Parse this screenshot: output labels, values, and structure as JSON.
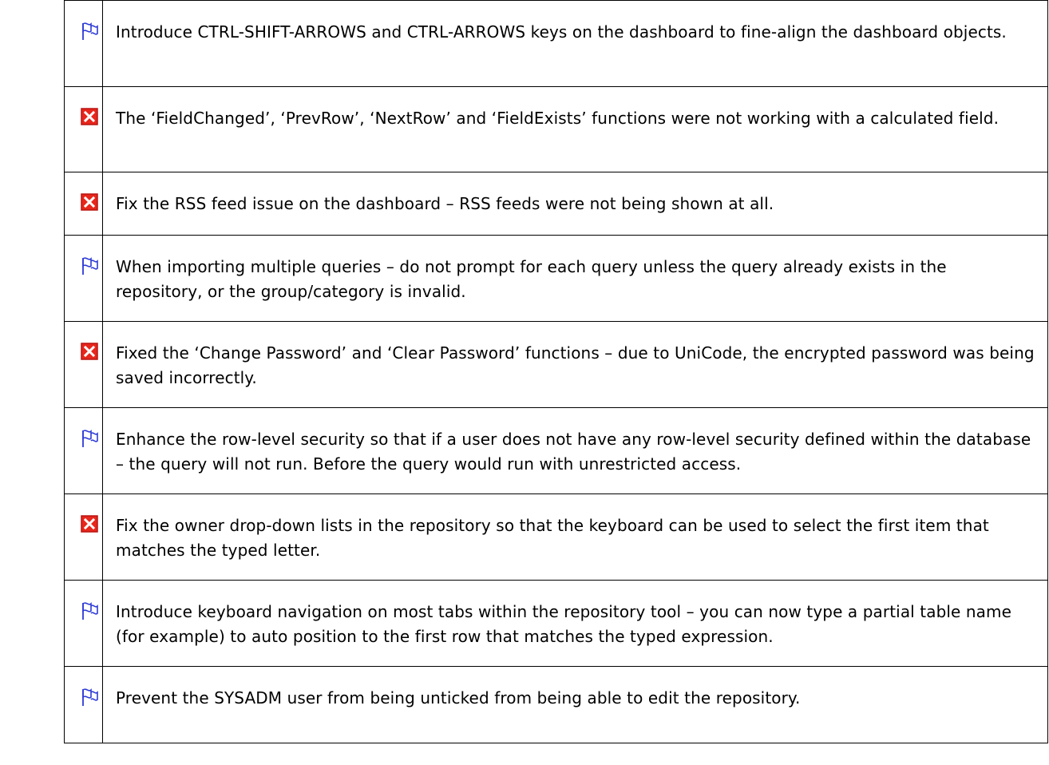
{
  "rows": [
    {
      "type": "enhancement",
      "icon": "flag-icon",
      "text": "Introduce CTRL-SHIFT-ARROWS and CTRL-ARROWS keys on the dashboard to fine-align the dashboard objects."
    },
    {
      "type": "fix",
      "icon": "red-x-icon",
      "text": "The ‘FieldChanged’, ‘PrevRow’, ‘NextRow’ and ‘FieldExists’ functions were not working with a calculated field."
    },
    {
      "type": "fix",
      "icon": "red-x-icon",
      "text": "Fix the RSS feed issue on the dashboard – RSS feeds were not being shown at all."
    },
    {
      "type": "enhancement",
      "icon": "flag-icon",
      "text": "When importing multiple queries – do not prompt for each query unless the query already exists in the repository, or the group/category is invalid."
    },
    {
      "type": "fix",
      "icon": "red-x-icon",
      "text": "Fixed the ‘Change Password’ and ‘Clear Password’ functions – due to UniCode, the encrypted password was being saved incorrectly."
    },
    {
      "type": "enhancement",
      "icon": "flag-icon",
      "text": "Enhance the row-level security so that if a user does not have any row-level security defined within the database – the query will not run.  Before the query would run with unrestricted access."
    },
    {
      "type": "fix",
      "icon": "red-x-icon",
      "text": "Fix the owner drop-down lists in the repository so that the keyboard can be used to select the first item that matches the typed letter."
    },
    {
      "type": "enhancement",
      "icon": "flag-icon",
      "text": "Introduce keyboard navigation on most tabs within the repository tool – you can now type a partial table name (for example) to auto position to the first row that matches the typed expression."
    },
    {
      "type": "enhancement",
      "icon": "flag-icon",
      "text": "Prevent the SYSADM user from being unticked from being able to edit the repository."
    }
  ],
  "colors": {
    "flag": "#2d3bd6",
    "fix_fill": "#e8261c",
    "fix_border": "#b81410"
  }
}
